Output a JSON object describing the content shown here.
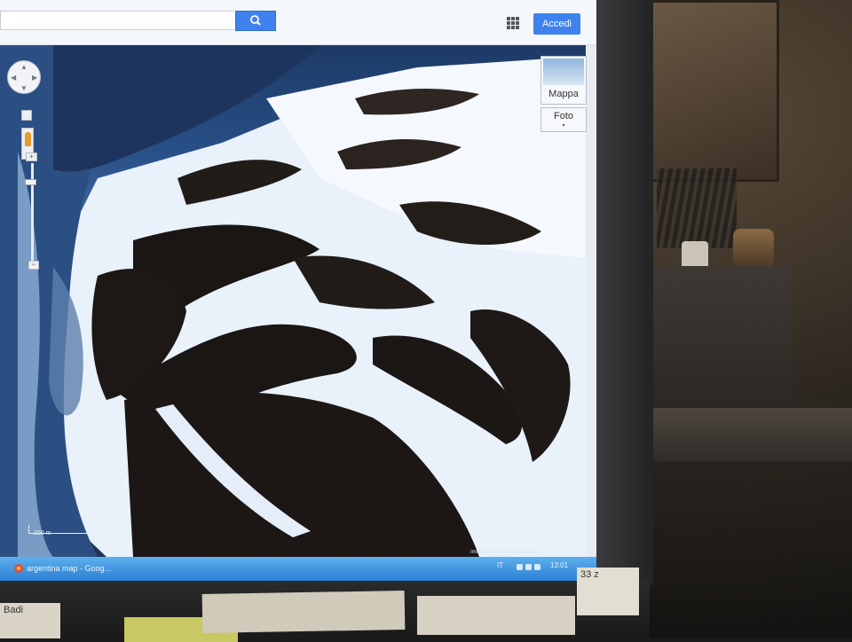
{
  "browser": {
    "search": {
      "value": "",
      "placeholder": ""
    },
    "signin_label": "Accedi",
    "apps_icon": "apps-grid-icon",
    "search_icon": "magnifier-icon"
  },
  "map_controls": {
    "map_type_label": "Mappa",
    "photo_label": "Foto",
    "photo_caret": "▾",
    "zoom_in": "+",
    "zoom_out": "−",
    "scale_label": "200 m",
    "attribution": "Immagini ©2013 DigitalGlobe"
  },
  "taskbar": {
    "window_label": "argentina map - Goog...",
    "language": "IT",
    "clock": "13:01"
  },
  "desk_notes": {
    "note_a": "Badi",
    "note_b": "",
    "note_c": "",
    "note_d": "33 z"
  },
  "colors": {
    "accent_blue": "#3f82ee",
    "taskbar_blue": "#2b7fd4"
  }
}
